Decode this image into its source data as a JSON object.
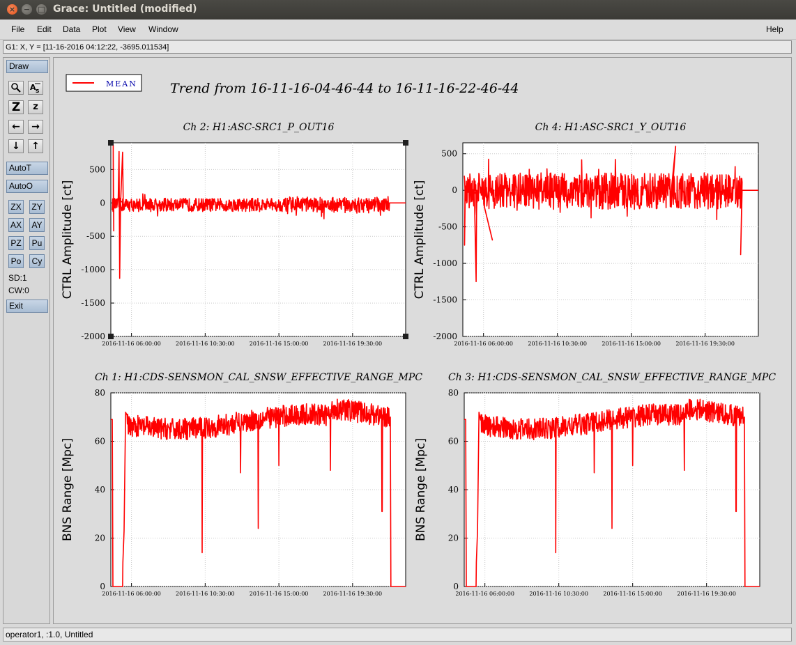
{
  "window": {
    "title": "Grace: Untitled (modified)",
    "controls": [
      "×",
      "−",
      "□"
    ]
  },
  "menu": {
    "items": [
      "File",
      "Edit",
      "Data",
      "Plot",
      "View",
      "Window"
    ],
    "help": "Help"
  },
  "locator": {
    "text": "G1: X, Y = [11-16-2016 04:12:22, -3695.011534]"
  },
  "toolbar": {
    "draw": "Draw",
    "zoom_icon": "magnifier-icon",
    "autoscale_text_icon": "autoscale-text-icon",
    "zoom_in_label": "Z",
    "zoom_out_label": "z",
    "left_arrow": "←",
    "right_arrow": "→",
    "down_arrow": "↓",
    "up_arrow": "↑",
    "autot": "AutoT",
    "autoo": "AutoO",
    "zx": "ZX",
    "zy": "ZY",
    "ax": "AX",
    "ay": "AY",
    "pz": "PZ",
    "pu": "Pu",
    "po": "Po",
    "cy": "Cy",
    "sd": "SD:1",
    "cw": "CW:0",
    "exit": "Exit"
  },
  "status": {
    "text": "operator1, :1.0, Untitled"
  },
  "plot": {
    "main_title": "Trend from 16-11-16-04-46-44 to 16-11-16-22-46-44",
    "legend": "MEAN",
    "line_color": "#ff0000",
    "x_ticks": [
      "2016-11-16 06:00:00",
      "2016-11-16 10:30:00",
      "2016-11-16 15:00:00",
      "2016-11-16 19:30:00"
    ]
  },
  "chart_data": [
    {
      "type": "line",
      "title": "Ch 2: H1:ASC-SRC1_P_OUT16",
      "ylabel": "CTRL Amplitude [ct]",
      "ylim": [
        -2000,
        900
      ],
      "yticks": [
        "500",
        "0",
        "-500",
        "-1000",
        "-1500",
        "-2000"
      ],
      "x": [
        "2016-11-16 04:46:44",
        "2016-11-16 22:46:44"
      ],
      "series": [
        {
          "name": "MEAN",
          "description_level": "noise about -20 with spread ±120",
          "values": [
            0,
            870,
            -420,
            770,
            -1130,
            760,
            -10,
            0,
            0
          ]
        }
      ]
    },
    {
      "type": "line",
      "title": "Ch 4: H1:ASC-SRC1_Y_OUT16",
      "ylabel": "CTRL Amplitude [ct]",
      "ylim": [
        -2000,
        650
      ],
      "yticks": [
        "500",
        "0",
        "-500",
        "-1000",
        "-1500",
        "-2000"
      ],
      "x": [
        "2016-11-16 04:46:44",
        "2016-11-16 22:46:44"
      ],
      "series": [
        {
          "name": "MEAN",
          "values": [
            -750,
            -1250,
            -680,
            600,
            -880,
            0
          ]
        }
      ]
    },
    {
      "type": "line",
      "title": "Ch 1: H1:CDS-SENSMON_CAL_SNSW_EFFECTIVE_RANGE_MPC",
      "ylabel": "BNS Range [Mpc]",
      "ylim": [
        0,
        80
      ],
      "yticks": [
        "80",
        "60",
        "40",
        "20",
        "0"
      ],
      "x": [
        "2016-11-16 04:46:44",
        "2016-11-16 22:46:44"
      ],
      "series": [
        {
          "name": "MEAN",
          "values": [
            69,
            0,
            0,
            10,
            72,
            68,
            14,
            47,
            24,
            50,
            48,
            31,
            72,
            0,
            0
          ]
        }
      ]
    },
    {
      "type": "line",
      "title": "Ch 3: H1:CDS-SENSMON_CAL_SNSW_EFFECTIVE_RANGE_MPC",
      "ylabel": "BNS Range [Mpc]",
      "ylim": [
        0,
        80
      ],
      "yticks": [
        "80",
        "60",
        "40",
        "20",
        "0"
      ],
      "x": [
        "2016-11-16 04:46:44",
        "2016-11-16 22:46:44"
      ],
      "series": [
        {
          "name": "MEAN",
          "values": [
            69,
            0,
            0,
            10,
            72,
            68,
            14,
            47,
            24,
            50,
            48,
            31,
            72,
            0,
            0
          ]
        }
      ]
    }
  ]
}
